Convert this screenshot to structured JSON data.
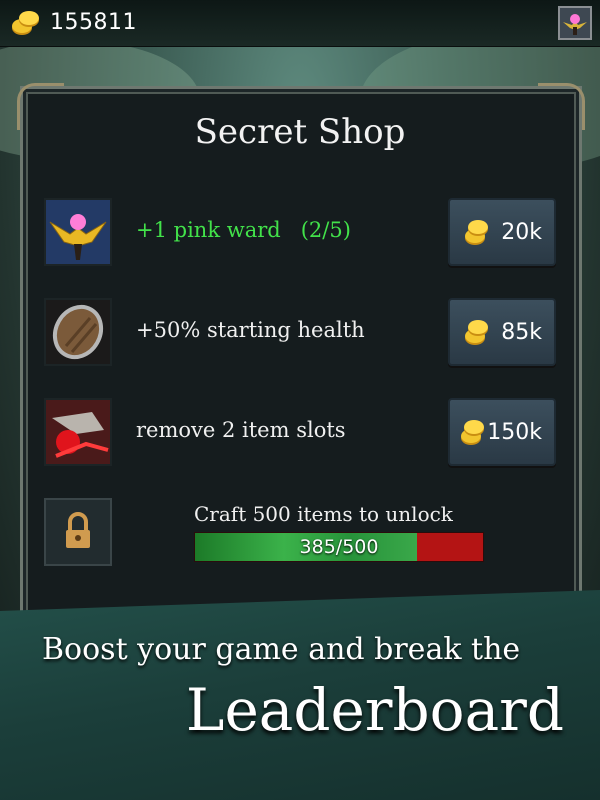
{
  "topbar": {
    "gold_amount": "155811",
    "gold_icon": "gold-coins-icon",
    "ward_icon": "pink-ward-icon"
  },
  "shop": {
    "title": "Secret Shop",
    "items": [
      {
        "icon": "winged-pink-ward-icon",
        "label": "+1 pink ward   (2/5)",
        "price": "20k",
        "highlight": true
      },
      {
        "icon": "shield-icon",
        "label": "+50% starting health",
        "price": "85k",
        "highlight": false
      },
      {
        "icon": "red-gauntlet-icon",
        "label": "remove 2 item slots",
        "price": "150k",
        "highlight": false
      }
    ],
    "locked": {
      "icon": "padlock-icon",
      "requirement": "Craft 500 items to unlock",
      "progress_label": "385/500",
      "progress_value": 385,
      "progress_max": 500
    }
  },
  "banner": {
    "tagline": "Boost your game and break the",
    "headline": "Leaderboard"
  },
  "colors": {
    "accent_green": "#42e24a",
    "progress_red": "#b41414",
    "button_bg": "#34475a"
  }
}
